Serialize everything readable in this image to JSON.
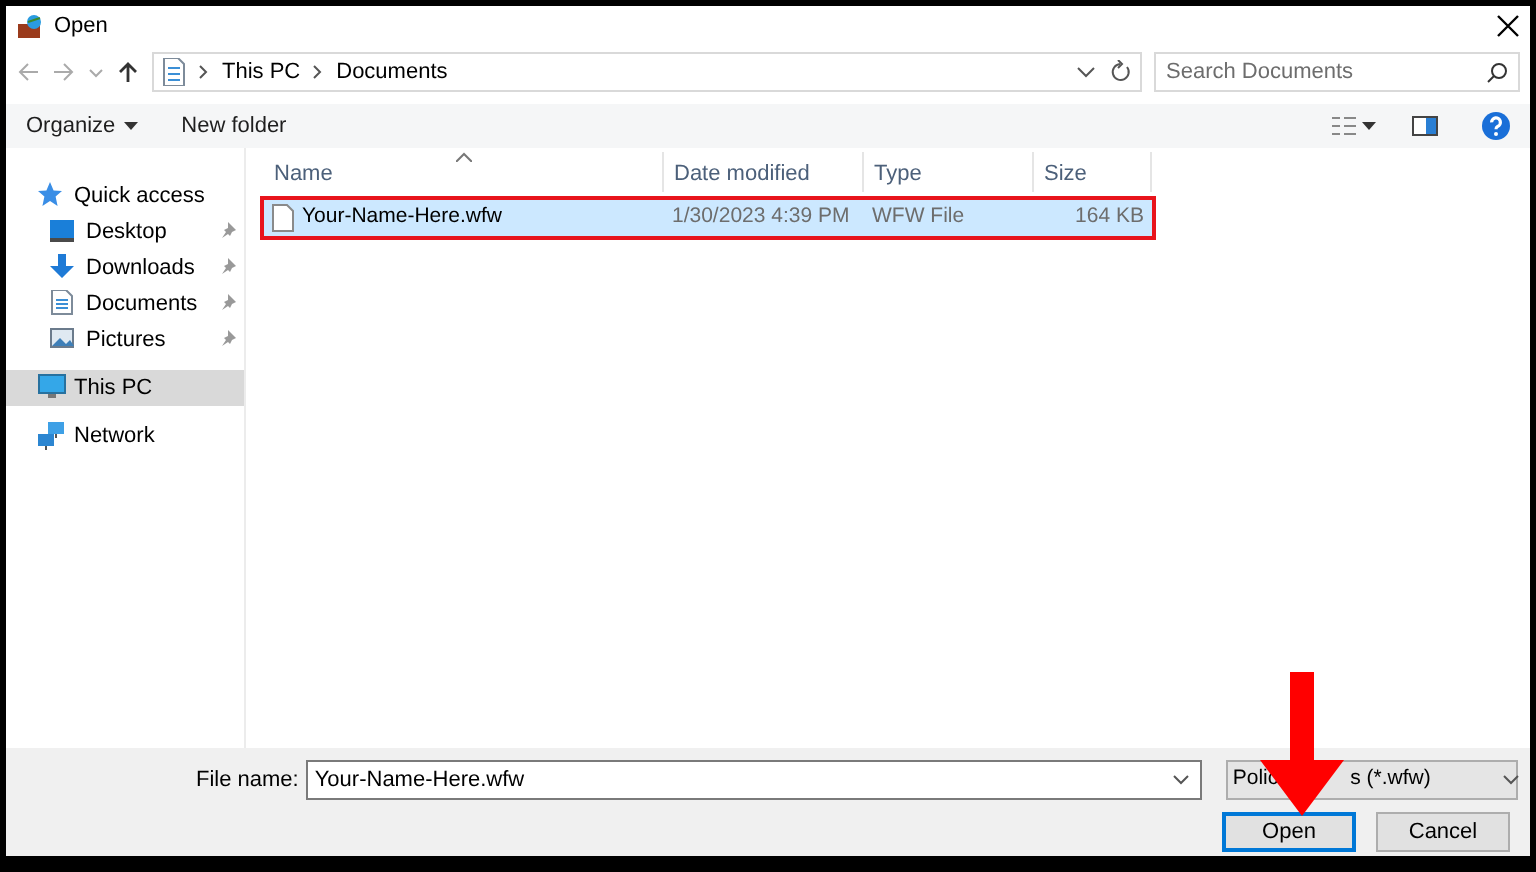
{
  "window": {
    "title": "Open"
  },
  "address": {
    "breadcrumbs": [
      "This PC",
      "Documents"
    ],
    "search_placeholder": "Search Documents"
  },
  "toolbar": {
    "buttons": [
      {
        "label": "Organize",
        "dropdown": true
      },
      {
        "label": "New folder",
        "dropdown": false
      }
    ]
  },
  "sidebar": {
    "items": [
      {
        "label": "Quick access",
        "selected": false,
        "children": [
          {
            "label": "Desktop",
            "pinned": true,
            "selected": false
          },
          {
            "label": "Downloads",
            "pinned": true,
            "selected": false
          },
          {
            "label": "Documents",
            "pinned": true,
            "selected": false
          },
          {
            "label": "Pictures",
            "pinned": true,
            "selected": false
          }
        ]
      },
      {
        "label": "This PC",
        "selected": true
      },
      {
        "label": "Network",
        "selected": false
      }
    ]
  },
  "table": {
    "columns": [
      {
        "label": "Name",
        "sorted": true
      },
      {
        "label": "Date modified",
        "sorted": false
      },
      {
        "label": "Type",
        "sorted": false
      },
      {
        "label": "Size",
        "sorted": false
      }
    ],
    "rows": [
      {
        "name": "Your-Name-Here.wfw",
        "date": "1/30/2023 4:39 PM",
        "type": "WFW File",
        "size": "164 KB",
        "selected": true,
        "outlined": true
      }
    ]
  },
  "footer": {
    "file_name_label": "File name:",
    "file_name": "Your-Name-Here.wfw",
    "file_type_parts": [
      "Polic",
      "s (*.wfw)"
    ],
    "buttons": [
      {
        "label": "Open",
        "default": true
      },
      {
        "label": "Cancel",
        "default": false
      }
    ]
  },
  "annotation": {
    "arrow": true
  }
}
